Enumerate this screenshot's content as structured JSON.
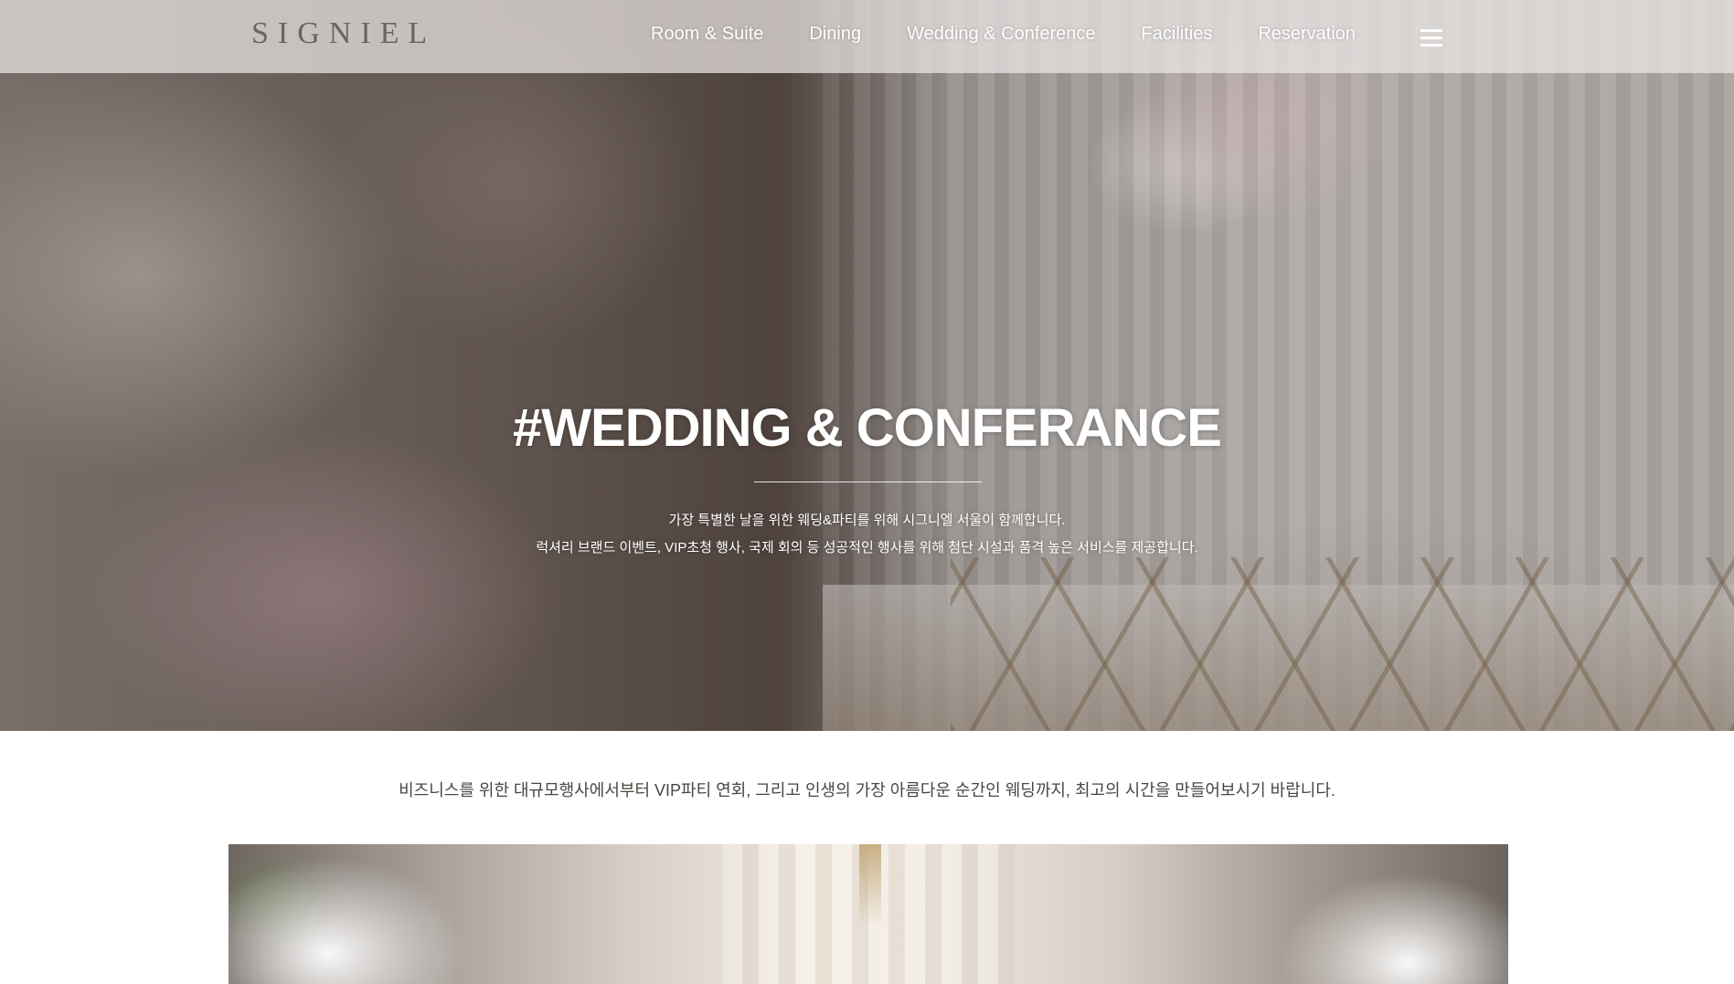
{
  "header": {
    "logo": "SIGNIEL",
    "nav": [
      {
        "label": "Room & Suite"
      },
      {
        "label": "Dining"
      },
      {
        "label": "Wedding & Conference"
      },
      {
        "label": "Facilities"
      },
      {
        "label": "Reservation"
      }
    ],
    "menu_icon": "hamburger-menu-icon"
  },
  "hero": {
    "title": "#WEDDING & CONFERANCE",
    "description_line1": "가장 특별한 날을 위한 웨딩&파티를 위해 시그니엘 서울이 함께합니다.",
    "description_line2": "럭셔리 브랜드 이벤트, VIP초청 행사, 국제 회의 등 성공적인 행사를 위해 첨단 시설과 품격 높은 서비스를 제공합니다."
  },
  "intro": {
    "text": "비즈니스를 위한 대규모행사에서부터 VIP파티 연회, 그리고 인생의 가장 아름다운 순간인 웨딩까지, 최고의 시간을 만들어보시기 바랍니다."
  },
  "colors": {
    "header_bg": "#ebe8e6",
    "logo": "#6a6561",
    "nav_text": "#ffffff",
    "intro_text": "#4a4642"
  }
}
